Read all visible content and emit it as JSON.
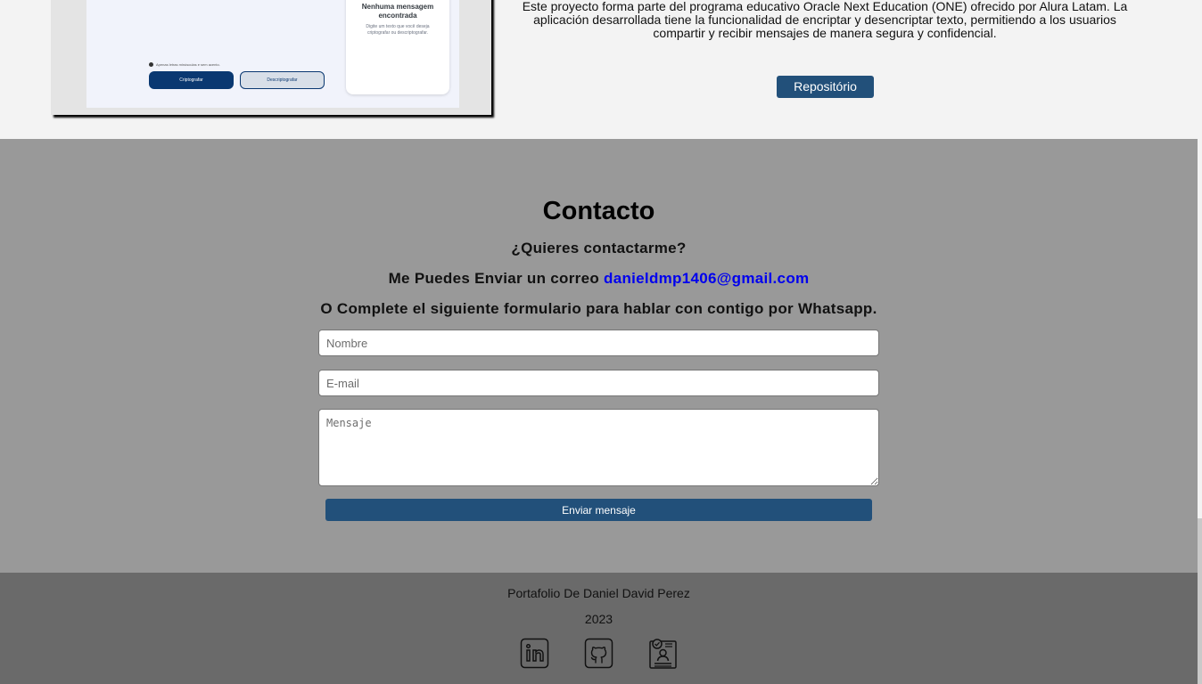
{
  "project": {
    "mockup": {
      "card_title": "Nenhuma mensagem encontrada",
      "card_text": "Digite um texto que você deseja criptografar ou descriptografar.",
      "hint": "Apenas letras minúsculas e sem acento.",
      "btn_encrypt": "Criptografar",
      "btn_decrypt": "Descriptografar"
    },
    "description": "Este proyecto forma parte del programa educativo Oracle Next Education (ONE) ofrecido por Alura Latam. La aplicación desarrollada tiene la funcionalidad de encriptar y desencriptar texto, permitiendo a los usuarios compartir y recibir mensajes de manera segura y confidencial.",
    "repo_button": "Repositório"
  },
  "contact": {
    "title": "Contacto",
    "question": "¿Quieres contactarme?",
    "mail_prefix": "Me Puedes Enviar un correo ",
    "email": "danieldmp1406@gmail.com",
    "form_text": "O Complete el siguiente formulario para hablar con contigo por Whatsapp.",
    "name_placeholder": "Nombre",
    "email_placeholder": "E-mail",
    "message_placeholder": "Mensaje",
    "send_button": "Enviar mensaje"
  },
  "footer": {
    "author": "Portafolio De Daniel David Perez",
    "year": "2023",
    "icons": [
      "linkedin-icon",
      "github-icon",
      "curriculum-icon"
    ]
  },
  "colors": {
    "button_blue": "#22507a",
    "contact_bg": "#999999",
    "footer_bg": "#6a6a6a",
    "link": "#0000ee"
  }
}
